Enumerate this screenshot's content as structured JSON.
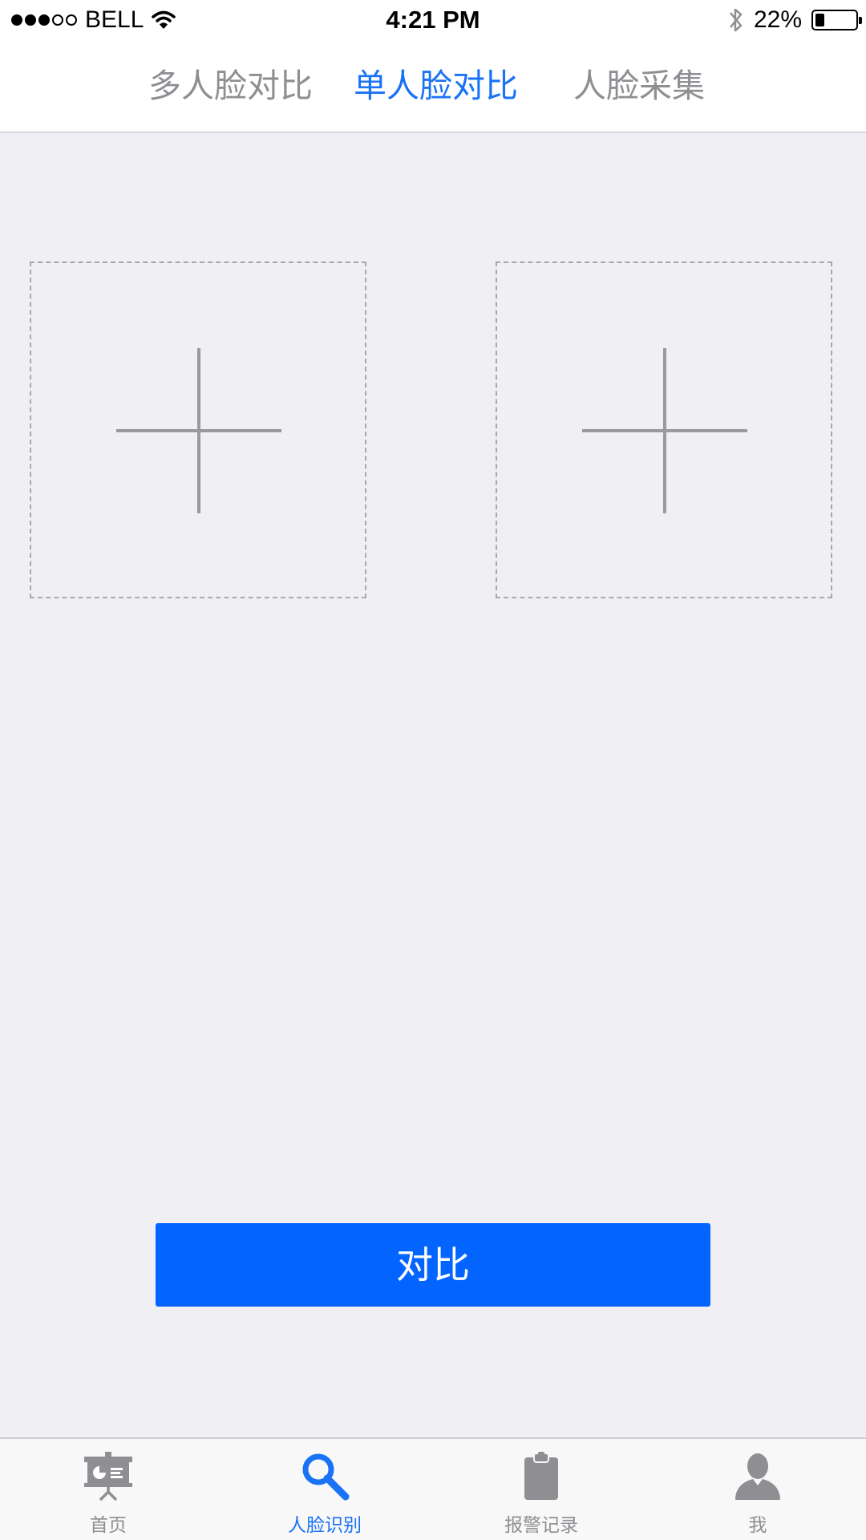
{
  "status_bar": {
    "carrier": "BELL",
    "signal_filled": 3,
    "signal_total": 5,
    "time": "4:21 PM",
    "battery_text": "22%",
    "battery_level": 0.22,
    "icons": [
      "signal-dots-icon",
      "wifi-icon",
      "bluetooth-icon",
      "battery-icon"
    ]
  },
  "top_tabs": [
    {
      "label": "多人脸对比",
      "active": false
    },
    {
      "label": "单人脸对比",
      "active": true
    },
    {
      "label": "人脸采集",
      "active": false
    }
  ],
  "photo_slots": [
    {
      "icon": "plus-icon"
    },
    {
      "icon": "plus-icon"
    }
  ],
  "compare_button": {
    "label": "对比"
  },
  "tab_bar": [
    {
      "label": "首页",
      "icon": "presentation-board-icon",
      "active": false
    },
    {
      "label": "人脸识别",
      "icon": "search-icon",
      "active": true
    },
    {
      "label": "报警记录",
      "icon": "clipboard-icon",
      "active": false
    },
    {
      "label": "我",
      "icon": "person-icon",
      "active": false
    }
  ],
  "colors": {
    "accent": "#1a73f5",
    "button": "#0364ff",
    "inactive": "#8e8e93",
    "background": "#efeff4"
  }
}
